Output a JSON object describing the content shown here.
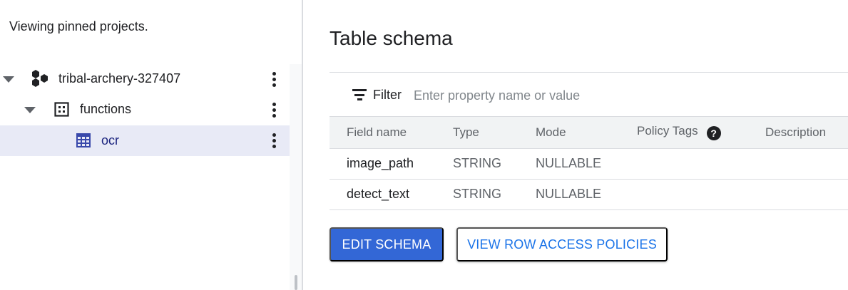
{
  "explorer": {
    "pinned_note": "Viewing pinned projects.",
    "tree": [
      {
        "label": "tribal-archery-327407",
        "icon": "project-hexagons-icon",
        "expanded": true
      },
      {
        "label": "functions",
        "icon": "dataset-icon",
        "expanded": true
      },
      {
        "label": "ocr",
        "icon": "table-icon",
        "selected": true
      }
    ]
  },
  "schema": {
    "title": "Table schema",
    "filter": {
      "label": "Filter",
      "placeholder": "Enter property name or value",
      "value": ""
    },
    "columns": [
      "Field name",
      "Type",
      "Mode",
      "Policy Tags",
      "Description"
    ],
    "rows": [
      {
        "field_name": "image_path",
        "type": "STRING",
        "mode": "NULLABLE",
        "policy_tags": "",
        "description": ""
      },
      {
        "field_name": "detect_text",
        "type": "STRING",
        "mode": "NULLABLE",
        "policy_tags": "",
        "description": ""
      }
    ],
    "buttons": {
      "edit_schema": "EDIT SCHEMA",
      "view_row_access": "VIEW ROW ACCESS POLICIES"
    }
  },
  "colors": {
    "primary_button": "#3367d6",
    "link_blue": "#1a73e8",
    "selected_row": "#e8eaf6",
    "table_icon_blue": "#3949ab"
  }
}
